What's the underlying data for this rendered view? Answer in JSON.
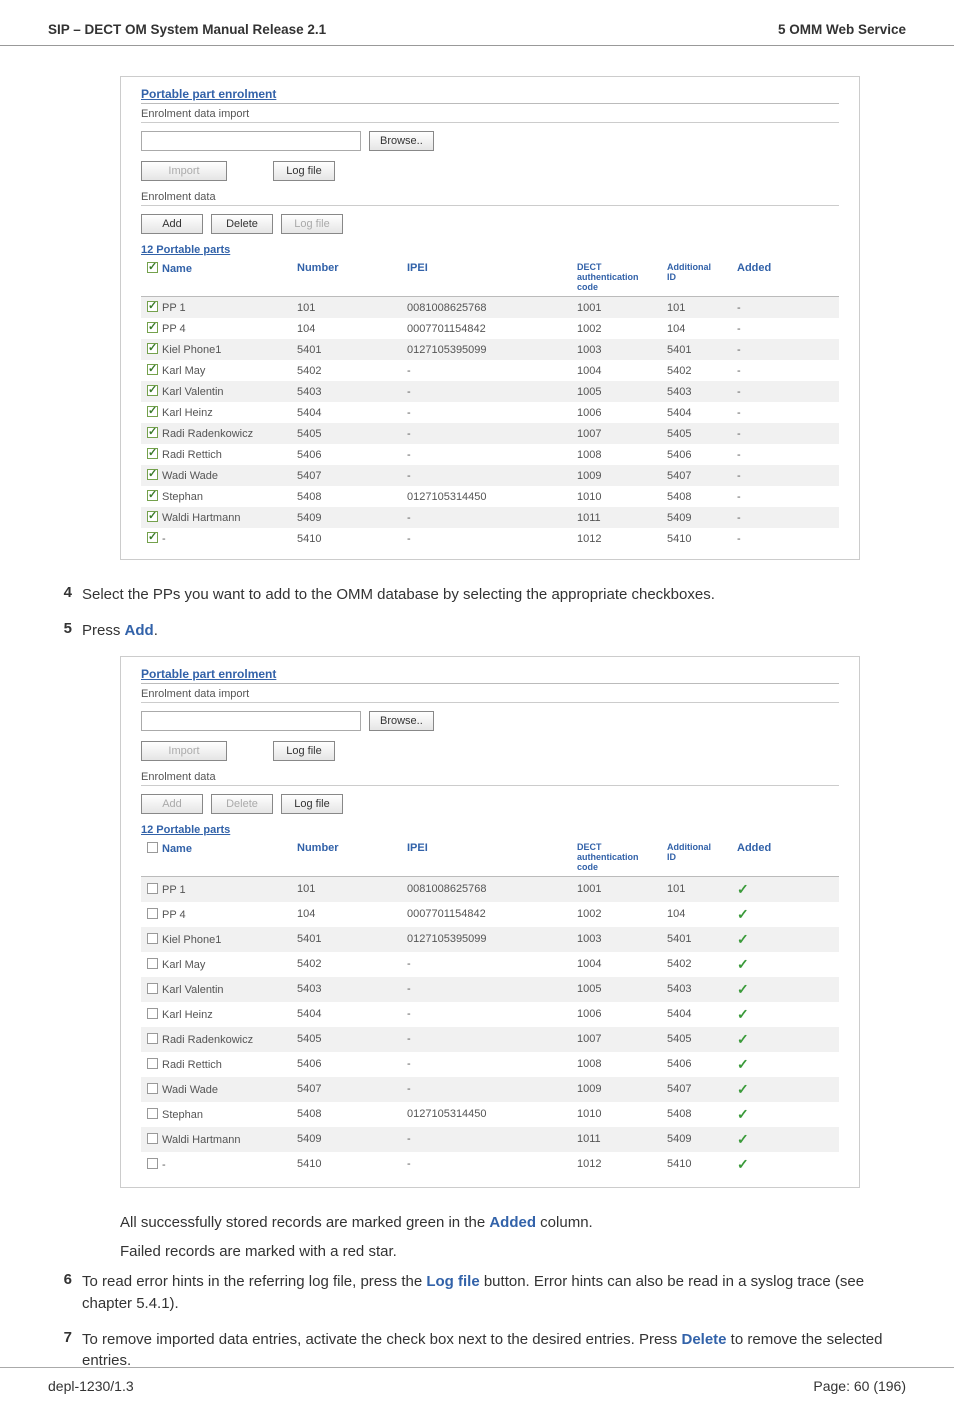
{
  "header": {
    "left": "SIP – DECT OM System Manual Release 2.1",
    "right": "5 OMM Web Service"
  },
  "panel1": {
    "title": "Portable part enrolment",
    "import_section": "Enrolment data import",
    "browse": "Browse..",
    "import_btn": "Import",
    "logfile_btn": "Log file",
    "data_section": "Enrolment data",
    "add_btn": "Add",
    "delete_btn": "Delete",
    "caption": "12 Portable parts",
    "headers": {
      "name": "Name",
      "number": "Number",
      "ipei": "IPEI",
      "dect_line1": "DECT",
      "dect_line2": "authentication",
      "dect_line3": "code",
      "addl_line1": "Additional",
      "addl_line2": "ID",
      "added": "Added"
    },
    "rows": [
      {
        "n": "PP 1",
        "num": "101",
        "ipei": "0081008625768",
        "dect": "1001",
        "aid": "101",
        "add": "-"
      },
      {
        "n": "PP 4",
        "num": "104",
        "ipei": "0007701154842",
        "dect": "1002",
        "aid": "104",
        "add": "-"
      },
      {
        "n": "Kiel Phone1",
        "num": "5401",
        "ipei": "0127105395099",
        "dect": "1003",
        "aid": "5401",
        "add": "-"
      },
      {
        "n": "Karl May",
        "num": "5402",
        "ipei": "-",
        "dect": "1004",
        "aid": "5402",
        "add": "-"
      },
      {
        "n": "Karl Valentin",
        "num": "5403",
        "ipei": "-",
        "dect": "1005",
        "aid": "5403",
        "add": "-"
      },
      {
        "n": "Karl Heinz",
        "num": "5404",
        "ipei": "-",
        "dect": "1006",
        "aid": "5404",
        "add": "-"
      },
      {
        "n": "Radi Radenkowicz",
        "num": "5405",
        "ipei": "-",
        "dect": "1007",
        "aid": "5405",
        "add": "-"
      },
      {
        "n": "Radi Rettich",
        "num": "5406",
        "ipei": "-",
        "dect": "1008",
        "aid": "5406",
        "add": "-"
      },
      {
        "n": "Wadi Wade",
        "num": "5407",
        "ipei": "-",
        "dect": "1009",
        "aid": "5407",
        "add": "-"
      },
      {
        "n": "Stephan",
        "num": "5408",
        "ipei": "0127105314450",
        "dect": "1010",
        "aid": "5408",
        "add": "-"
      },
      {
        "n": "Waldi Hartmann",
        "num": "5409",
        "ipei": "-",
        "dect": "1011",
        "aid": "5409",
        "add": "-"
      },
      {
        "n": "-",
        "num": "5410",
        "ipei": "-",
        "dect": "1012",
        "aid": "5410",
        "add": "-"
      }
    ]
  },
  "steps": {
    "s4": "Select the PPs you want to add to the OMM database by selecting the appropriate checkboxes.",
    "s5_pre": "Press ",
    "s5_kw": "Add",
    "s5_post": "."
  },
  "panel2": {
    "rows": [
      {
        "n": "PP 1",
        "num": "101",
        "ipei": "0081008625768",
        "dect": "1001",
        "aid": "101",
        "add": "✓"
      },
      {
        "n": "PP 4",
        "num": "104",
        "ipei": "0007701154842",
        "dect": "1002",
        "aid": "104",
        "add": "✓"
      },
      {
        "n": "Kiel Phone1",
        "num": "5401",
        "ipei": "0127105395099",
        "dect": "1003",
        "aid": "5401",
        "add": "✓"
      },
      {
        "n": "Karl May",
        "num": "5402",
        "ipei": "-",
        "dect": "1004",
        "aid": "5402",
        "add": "✓"
      },
      {
        "n": "Karl Valentin",
        "num": "5403",
        "ipei": "-",
        "dect": "1005",
        "aid": "5403",
        "add": "✓"
      },
      {
        "n": "Karl Heinz",
        "num": "5404",
        "ipei": "-",
        "dect": "1006",
        "aid": "5404",
        "add": "✓"
      },
      {
        "n": "Radi Radenkowicz",
        "num": "5405",
        "ipei": "-",
        "dect": "1007",
        "aid": "5405",
        "add": "✓"
      },
      {
        "n": "Radi Rettich",
        "num": "5406",
        "ipei": "-",
        "dect": "1008",
        "aid": "5406",
        "add": "✓"
      },
      {
        "n": "Wadi Wade",
        "num": "5407",
        "ipei": "-",
        "dect": "1009",
        "aid": "5407",
        "add": "✓"
      },
      {
        "n": "Stephan",
        "num": "5408",
        "ipei": "0127105314450",
        "dect": "1010",
        "aid": "5408",
        "add": "✓"
      },
      {
        "n": "Waldi Hartmann",
        "num": "5409",
        "ipei": "-",
        "dect": "1011",
        "aid": "5409",
        "add": "✓"
      },
      {
        "n": "-",
        "num": "5410",
        "ipei": "-",
        "dect": "1012",
        "aid": "5410",
        "add": "✓"
      }
    ]
  },
  "after": {
    "p1_pre": "All successfully stored records are marked green in the ",
    "p1_kw": "Added",
    "p1_post": " column.",
    "p2": "Failed records are marked with a red star.",
    "s6_pre": "To read error hints in the referring log file, press the ",
    "s6_kw": "Log file",
    "s6_post": " button. Error hints can also be read in a syslog trace (see chapter 5.4.1).",
    "s7_pre": "To remove imported data entries, activate the check box next to the desired entries. Press ",
    "s7_kw": "Delete",
    "s7_post": " to remove the selected entries."
  },
  "footer": {
    "left": "depl-1230/1.3",
    "right": "Page: 60 (196)"
  }
}
